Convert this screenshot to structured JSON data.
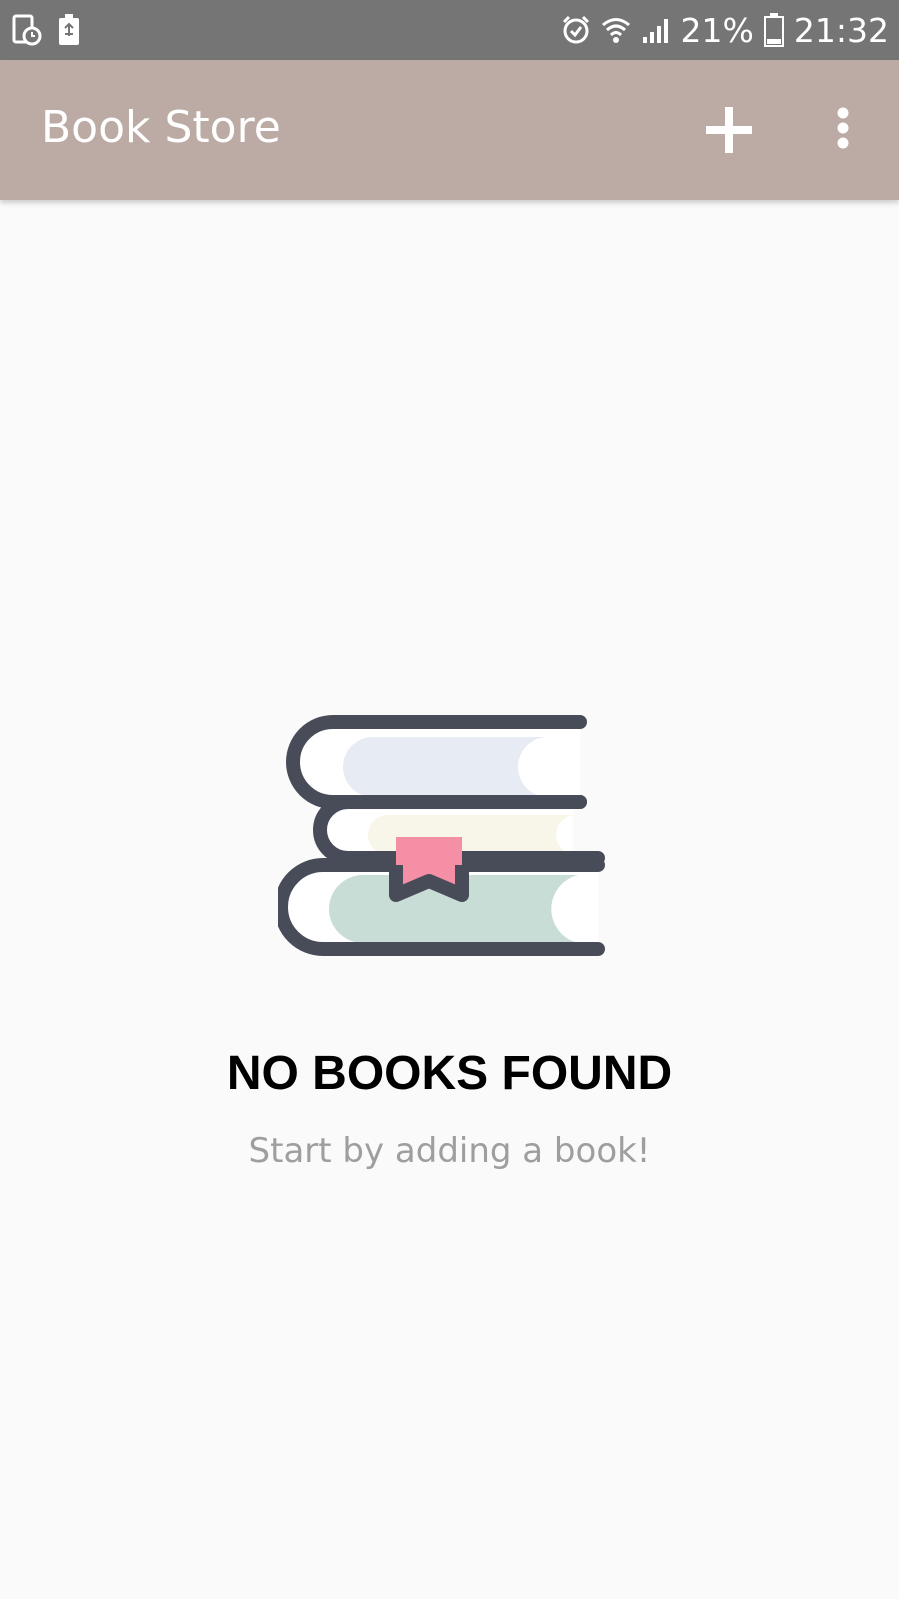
{
  "status_bar": {
    "battery_percent": "21%",
    "time": "21:32",
    "icons": [
      "screen-timer-icon",
      "recycle-notification-icon",
      "alarm-icon",
      "wifi-icon",
      "signal-icon",
      "battery-icon"
    ]
  },
  "app_bar": {
    "title": "Book Store",
    "color": "#bcaaa4",
    "actions": [
      "add-icon",
      "overflow-menu-icon"
    ]
  },
  "empty_state": {
    "illustration": "books-stack-icon",
    "title": "NO BOOKS FOUND",
    "subtitle": "Start by adding a book!",
    "colors": {
      "outline": "#474c58",
      "top_book": "#e7ebf3",
      "middle_book": "#f8f6e8",
      "bottom_book": "#c8ddd5",
      "bookmark": "#f48fa6"
    }
  }
}
